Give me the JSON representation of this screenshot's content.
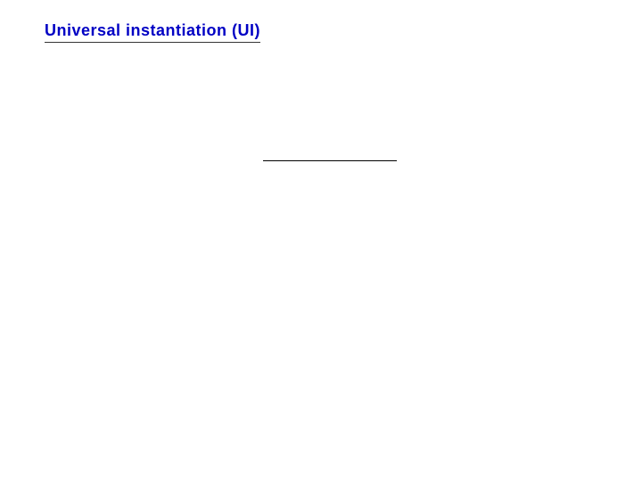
{
  "slide": {
    "title": "Universal instantiation (UI)"
  }
}
